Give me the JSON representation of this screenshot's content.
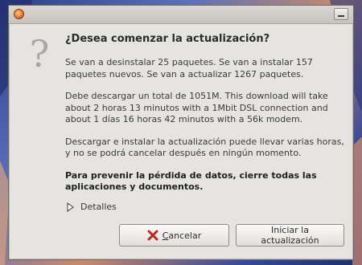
{
  "dialog": {
    "heading": "¿Desea comenzar la actualización?",
    "paragraphs": [
      "Se van a desinstalar 25 paquetes. Se van a instalar 157 paquetes nuevos. Se van a actualizar 1267 paquetes.",
      "Debe descargar un total de 1051M. This download will take about 2 horas 13 minutos with a 1Mbit DSL connection and about 1 días 16 horas 42 minutos with a 56k modem.",
      "Descargar e instalar la actualización puede llevar varias horas, y no se podrá cancelar después en ningún momento."
    ],
    "warning": "Para prevenir la pérdida de datos, cierre todas las aplicaciones y documentos.",
    "details_label": "Detalles",
    "icon": "question-mark-icon"
  },
  "buttons": {
    "cancel_label": "Cancelar",
    "start_label": "Iniciar la actualización"
  },
  "colors": {
    "dialog_bg": "#e6e4e0",
    "cancel_icon": "#c0251c"
  }
}
